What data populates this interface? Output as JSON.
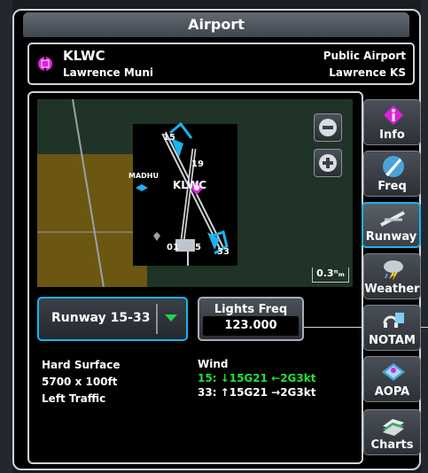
{
  "window": {
    "title": "Airport"
  },
  "airport": {
    "ident": "KLWC",
    "name": "Lawrence Muni",
    "type": "Public Airport",
    "location": "Lawrence KS"
  },
  "map": {
    "zoom_out_icon": "minus-circle-icon",
    "zoom_in_icon": "plus-circle-icon",
    "labels": {
      "runway_15": "15",
      "runway_19": "19",
      "runway_01": "01",
      "runway_33": "33",
      "runway_5": "5",
      "fix": "MADHU",
      "airport": "KLWC"
    },
    "scale": "0.3ⁿₘ"
  },
  "runway_select": {
    "label": "Runway 15-33"
  },
  "lights": {
    "title": "Lights Freq",
    "freq": "123.000"
  },
  "runway_info": {
    "surface": "Hard Surface",
    "dimensions": "5700 x 100ft",
    "traffic": "Left Traffic"
  },
  "wind": {
    "label": "Wind",
    "rwy15": "15: ↓15G21 ←2G3kt",
    "rwy33": "33: ↑15G21 →2G3kt"
  },
  "tabs": [
    {
      "label": "Info",
      "icon": "info-icon"
    },
    {
      "label": "Freq",
      "icon": "frequency-icon"
    },
    {
      "label": "Runway",
      "icon": "runway-icon"
    },
    {
      "label": "Weather",
      "icon": "weather-icon"
    },
    {
      "label": "NOTAM",
      "icon": "notam-icon"
    },
    {
      "label": "AOPA",
      "icon": "aopa-icon"
    },
    {
      "label": "Charts",
      "icon": "charts-icon"
    }
  ],
  "colors": {
    "accent": "#18b4ef",
    "wind_highlight": "#22e03c",
    "airport_symbol": "#e020e0",
    "terrain": "#6b5612"
  }
}
